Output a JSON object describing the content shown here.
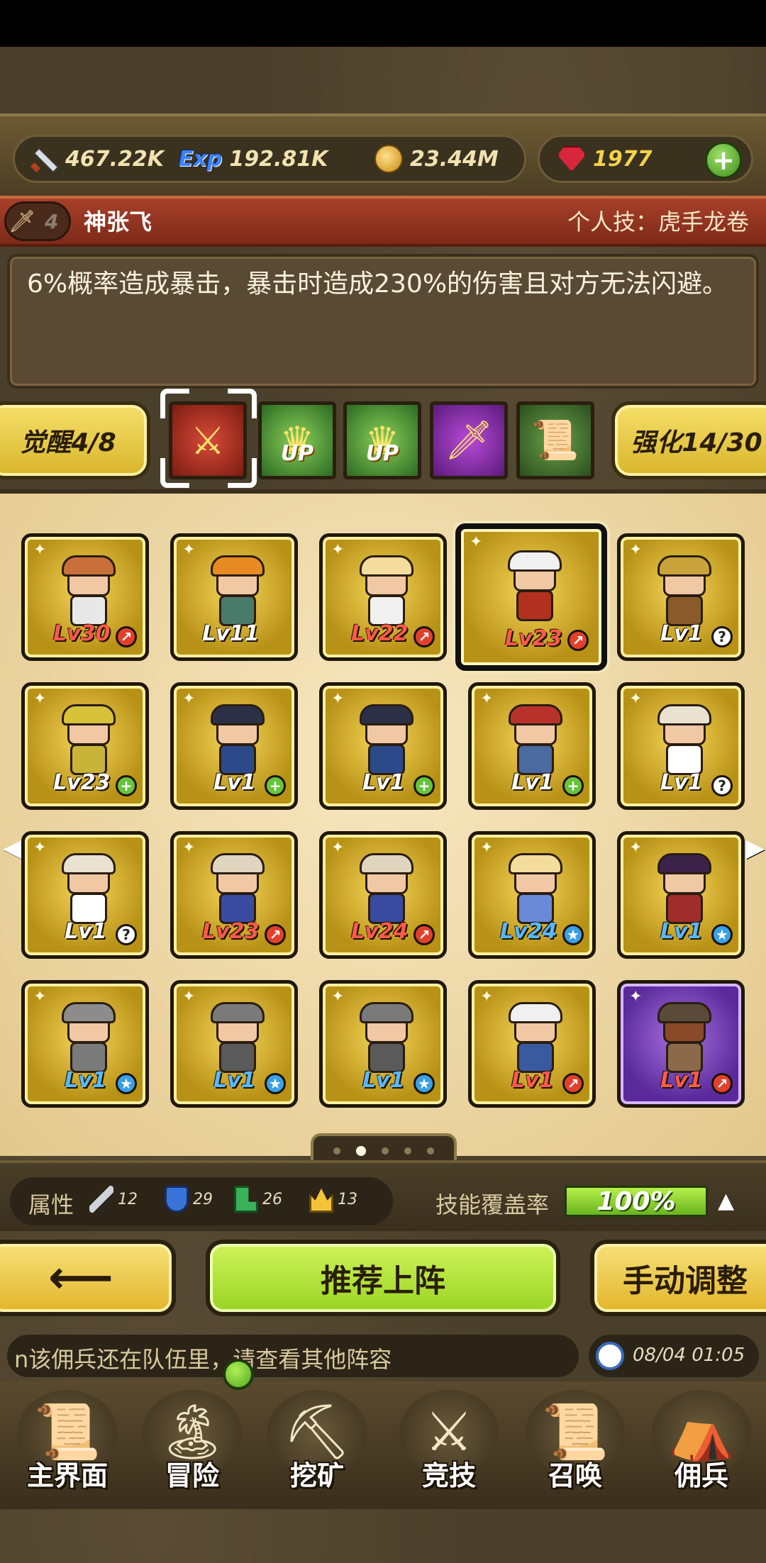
{
  "resources": {
    "attack": "467.22K",
    "exp_icon": "Exp",
    "exp": "192.81K",
    "gold": "23.44M",
    "gems": "1977"
  },
  "hero": {
    "rank": "4",
    "name": "神张飞",
    "skill_label": "个人技：虎手龙卷",
    "description": "6%概率造成暴击，暴击时造成230%的伤害且对方无法闪避。"
  },
  "tabs": {
    "awaken": "觉醒4/8",
    "enhance": "强化14/30",
    "up_label": "UP"
  },
  "heroes": [
    {
      "level": "Lv30",
      "badge": "red",
      "lvcolor": "red"
    },
    {
      "level": "Lv11",
      "badge": "none",
      "lvcolor": "white"
    },
    {
      "level": "Lv22",
      "badge": "red",
      "lvcolor": "red"
    },
    {
      "level": "Lv23",
      "badge": "red",
      "lvcolor": "red"
    },
    {
      "level": "Lv1",
      "badge": "gray",
      "lvcolor": "white"
    },
    {
      "level": "Lv23",
      "badge": "green",
      "lvcolor": "white"
    },
    {
      "level": "Lv1",
      "badge": "green",
      "lvcolor": "white"
    },
    {
      "level": "Lv1",
      "badge": "green",
      "lvcolor": "white"
    },
    {
      "level": "Lv1",
      "badge": "green",
      "lvcolor": "white"
    },
    {
      "level": "Lv1",
      "badge": "gray",
      "lvcolor": "white"
    },
    {
      "level": "Lv1",
      "badge": "gray",
      "lvcolor": "white"
    },
    {
      "level": "Lv23",
      "badge": "red",
      "lvcolor": "red"
    },
    {
      "level": "Lv24",
      "badge": "red",
      "lvcolor": "red"
    },
    {
      "level": "Lv24",
      "badge": "blue",
      "lvcolor": "blue"
    },
    {
      "level": "Lv1",
      "badge": "blue",
      "lvcolor": "blue"
    },
    {
      "level": "Lv1",
      "badge": "blue",
      "lvcolor": "blue"
    },
    {
      "level": "Lv1",
      "badge": "blue",
      "lvcolor": "blue"
    },
    {
      "level": "Lv1",
      "badge": "blue",
      "lvcolor": "blue"
    },
    {
      "level": "Lv1",
      "badge": "red",
      "lvcolor": "red"
    },
    {
      "level": "Lv1",
      "badge": "red",
      "lvcolor": "red"
    }
  ],
  "attributes": {
    "label": "属性",
    "dagger": "12",
    "shield": "29",
    "boot": "26",
    "crown": "13"
  },
  "coverage": {
    "label": "技能覆盖率",
    "value": "100%"
  },
  "actions": {
    "back": "⟵",
    "recommend": "推荐上阵",
    "manual": "手动调整"
  },
  "ticker": {
    "text": "n该佣兵还在队伍里，请查看其他阵容",
    "time": "08/04 01:05"
  },
  "nav": [
    {
      "label": "主界面",
      "icon": "📜"
    },
    {
      "label": "冒险",
      "icon": "🏝"
    },
    {
      "label": "挖矿",
      "icon": "⛏"
    },
    {
      "label": "竞技",
      "icon": "⚔"
    },
    {
      "label": "召唤",
      "icon": "📜"
    },
    {
      "label": "佣兵",
      "icon": "⛺"
    }
  ]
}
